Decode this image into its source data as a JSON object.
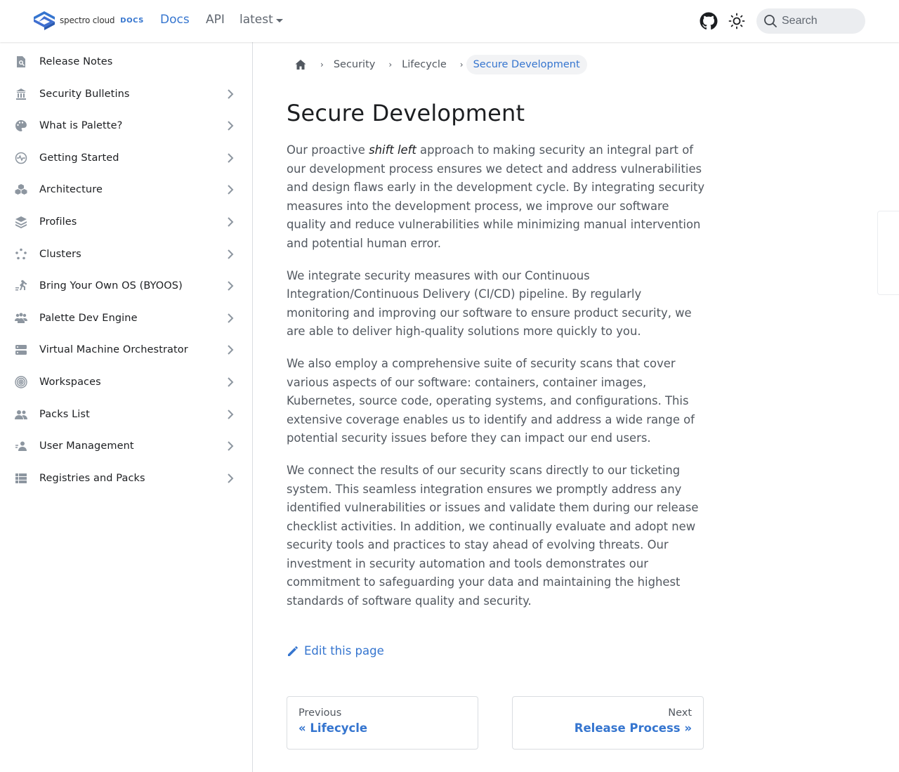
{
  "brand": {
    "name": "spectro cloud",
    "docs": "DOCS",
    "accent": "#3575cf"
  },
  "nav": {
    "docs": "Docs",
    "api": "API",
    "version": "latest",
    "search_placeholder": "Search"
  },
  "sidebar": {
    "items": [
      {
        "label": "Release Notes",
        "icon": "release-notes-icon",
        "expandable": false
      },
      {
        "label": "Security Bulletins",
        "icon": "bank-icon",
        "expandable": true
      },
      {
        "label": "What is Palette?",
        "icon": "palette-icon",
        "expandable": true
      },
      {
        "label": "Getting Started",
        "icon": "heartbeat-icon",
        "expandable": true
      },
      {
        "label": "Architecture",
        "icon": "cubes-icon",
        "expandable": true
      },
      {
        "label": "Profiles",
        "icon": "layers-icon",
        "expandable": true
      },
      {
        "label": "Clusters",
        "icon": "cluster-icon",
        "expandable": true
      },
      {
        "label": "Bring Your Own OS (BYOOS)",
        "icon": "runner-icon",
        "expandable": true
      },
      {
        "label": "Palette Dev Engine",
        "icon": "users-icon",
        "expandable": true
      },
      {
        "label": "Virtual Machine Orchestrator",
        "icon": "server-icon",
        "expandable": true
      },
      {
        "label": "Workspaces",
        "icon": "target-icon",
        "expandable": true
      },
      {
        "label": "Packs List",
        "icon": "user-group-icon",
        "expandable": true
      },
      {
        "label": "User Management",
        "icon": "user-management-icon",
        "expandable": true
      },
      {
        "label": "Registries and Packs",
        "icon": "list-icon",
        "expandable": true
      }
    ]
  },
  "breadcrumb": {
    "items": [
      "Security",
      "Lifecycle"
    ],
    "current": "Secure Development"
  },
  "page": {
    "title": "Secure Development",
    "p1_before": "Our proactive ",
    "p1_em": "shift left",
    "p1_after": " approach to making security an integral part of our development process ensures we detect and address vulnerabilities and design flaws early in the development cycle. By integrating security measures into the development process, we improve our software quality and reduce vulnerabilities while minimizing manual intervention and potential human error.",
    "p2": "We integrate security measures with our Continuous Integration/Continuous Delivery (CI/CD) pipeline. By regularly monitoring and improving our software to ensure product security, we are able to deliver high-quality solutions more quickly to you.",
    "p3": "We also employ a comprehensive suite of security scans that cover various aspects of our software: containers, container images, Kubernetes, source code, operating systems, and configurations. This extensive coverage enables us to identify and address a wide range of potential security issues before they can impact our end users.",
    "p4": "We connect the results of our security scans directly to our ticketing system. This seamless integration ensures we promptly address any identified vulnerabilities or issues and validate them during our release checklist activities. In addition, we continually evaluate and adopt new security tools and practices to stay ahead of evolving threats. Our investment in security automation and tools demonstrates our commitment to safeguarding your data and maintaining the highest standards of software quality and security.",
    "edit": "Edit this page"
  },
  "pagination": {
    "prev_sub": "Previous",
    "prev_label": "« Lifecycle",
    "next_sub": "Next",
    "next_label": "Release Process »"
  }
}
